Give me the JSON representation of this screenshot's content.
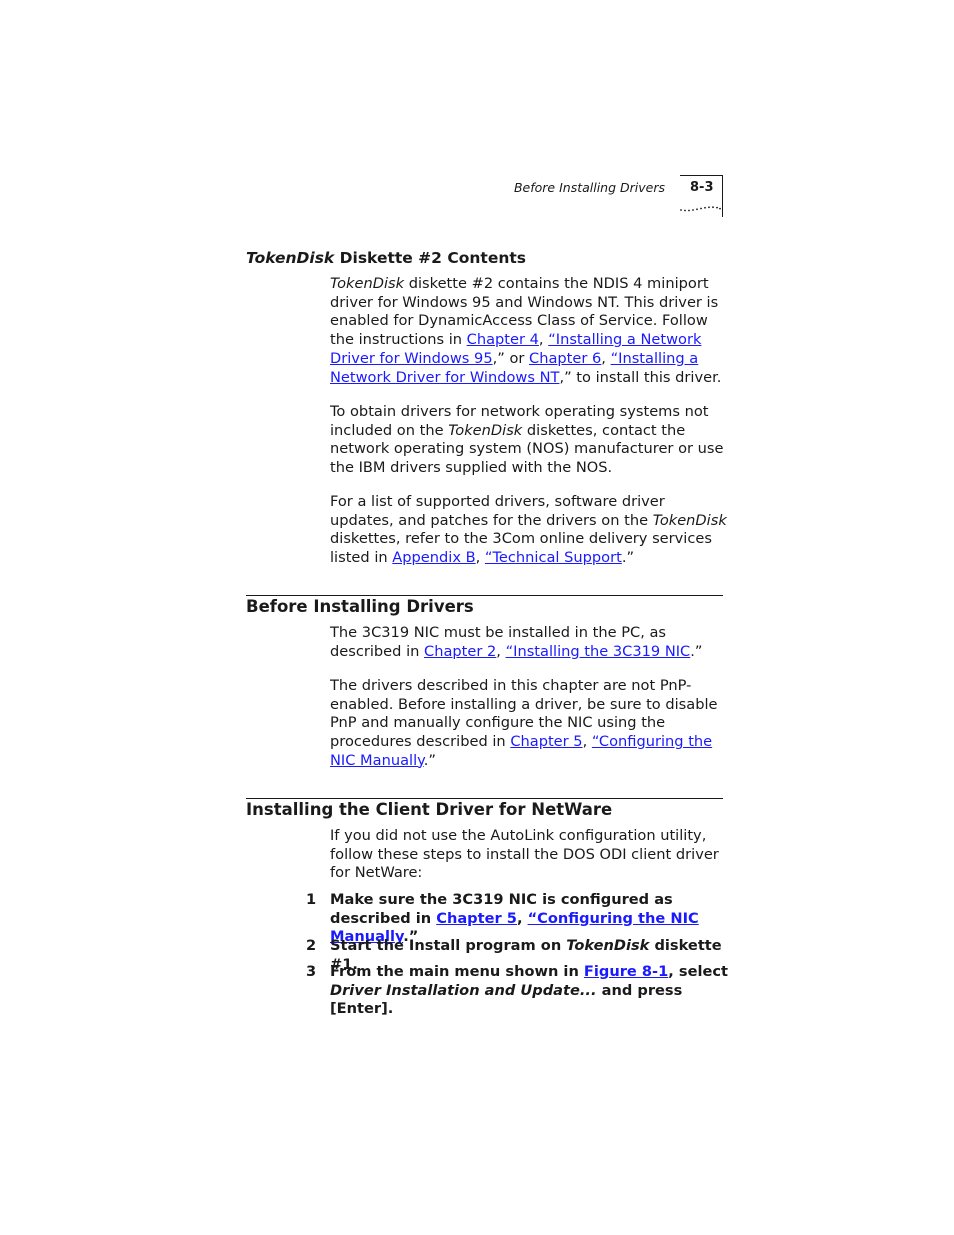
{
  "header": {
    "running_title": "Before Installing Drivers",
    "page_number": "8-3"
  },
  "section_tokendisk": {
    "heading_italic": "TokenDisk",
    "heading_rest": " Diskette #2 Contents",
    "p1": {
      "t1": "TokenDisk",
      "t2": " diskette #2 contains the NDIS 4 miniport driver for Windows 95 and Windows NT. This driver is enabled for DynamicAccess Class of Service. Follow the instructions in ",
      "link1": "Chapter 4",
      "t3": ", ",
      "link2": "“Installing a Network Driver for Windows 95",
      "t4": ",” or ",
      "link3": "Chapter 6",
      "t5": ", ",
      "link4": "“Installing a Network Driver for Windows NT",
      "t6": ",” to install this driver."
    },
    "p2": {
      "t1": "To obtain drivers for network operating systems not included on the ",
      "t2": "TokenDisk",
      "t3": " diskettes, contact the network operating system (NOS) manufacturer or use the IBM drivers supplied with the NOS."
    },
    "p3": {
      "t1": "For a list of supported drivers, software driver updates, and patches for the drivers on the ",
      "t2": "TokenDisk",
      "t3": " diskettes, refer to the 3Com online delivery services listed in ",
      "link1": "Appendix B",
      "t4": ", ",
      "link2": "“Technical Support",
      "t5": ".”"
    }
  },
  "section_before": {
    "heading": "Before Installing Drivers",
    "p1": {
      "t1": "The 3C319 NIC must be installed in the PC, as described in ",
      "link1": "Chapter 2",
      "t2": ", ",
      "link2": "“Installing the 3C319 NIC",
      "t3": ".”"
    },
    "p2": {
      "t1": "The drivers described in this chapter are not PnP-enabled. Before installing a driver, be sure to disable PnP and manually configure the NIC using the procedures described in ",
      "link1": "Chapter 5",
      "t2": ", ",
      "link2": "“Configuring the NIC Manually",
      "t3": ".”"
    }
  },
  "section_netware": {
    "heading": "Installing the Client Driver for NetWare",
    "intro": "If you did not use the AutoLink configuration utility, follow these steps to install the DOS ODI client driver for NetWare:",
    "steps": [
      {
        "num": "1",
        "t1": "Make sure the 3C319 NIC is configured as described in ",
        "link1": "Chapter 5",
        "t2": ", ",
        "link2": "“Configuring the NIC Manually",
        "t3": ".”"
      },
      {
        "num": "2",
        "t1": "Start the Install program on ",
        "t2": "TokenDisk",
        "t3": " diskette #1."
      },
      {
        "num": "3",
        "t1": "From the main menu shown in ",
        "link1": "Figure 8-1",
        "t2": ", select ",
        "t3": "Driver Installation and Update...",
        "t4": " and press [Enter]."
      }
    ]
  }
}
